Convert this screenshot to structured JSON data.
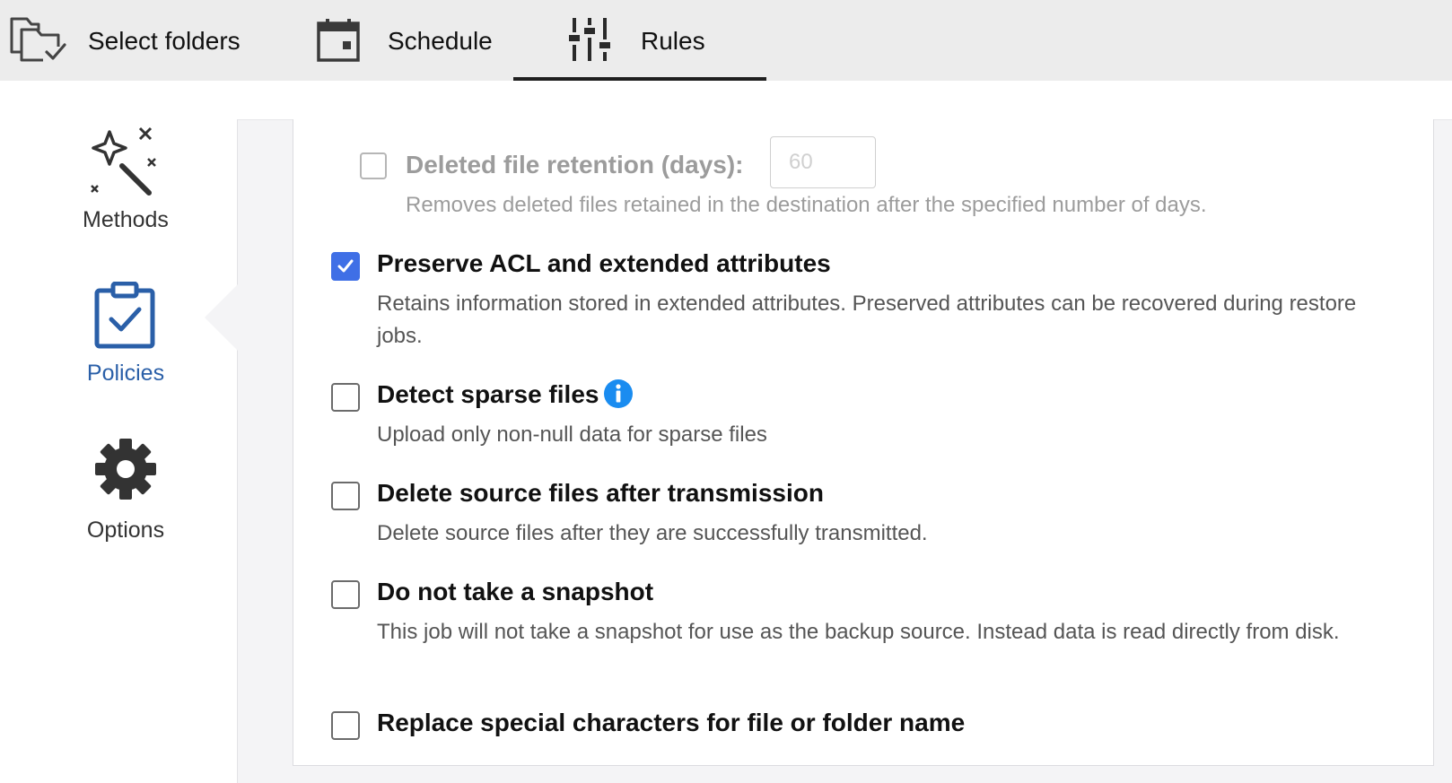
{
  "tabs": [
    {
      "label": "Select folders",
      "icon": "folder-check-icon"
    },
    {
      "label": "Schedule",
      "icon": "calendar-icon"
    },
    {
      "label": "Rules",
      "icon": "sliders-icon",
      "active": true
    }
  ],
  "sidebar": {
    "items": [
      {
        "label": "Methods",
        "icon": "magic-wand-icon"
      },
      {
        "label": "Policies",
        "icon": "clipboard-check-icon",
        "active": true
      },
      {
        "label": "Options",
        "icon": "gear-icon"
      }
    ]
  },
  "rules": {
    "retention": {
      "title": "Deleted file retention (days):",
      "placeholder": "60",
      "description": "Removes deleted files retained in the destination after the specified number of days.",
      "checked": false,
      "disabled": true
    },
    "preserve_acl": {
      "title": "Preserve ACL and extended attributes",
      "description": "Retains information stored in extended attributes. Preserved attributes can be recovered during restore jobs.",
      "checked": true
    },
    "sparse": {
      "title": "Detect sparse files",
      "description": "Upload only non-null data for sparse files",
      "checked": false
    },
    "delete_source": {
      "title": "Delete source files after transmission",
      "description": "Delete source files after they are successfully transmitted.",
      "checked": false
    },
    "no_snapshot": {
      "title": "Do not take a snapshot",
      "description": "This job will not take a snapshot for use as the backup source. Instead data is read directly from disk.",
      "checked": false
    },
    "replace_special": {
      "title": "Replace special characters for file or folder name",
      "checked": false
    }
  },
  "colors": {
    "accent": "#3f6fe6",
    "active_nav": "#2a5fa8",
    "info": "#1a8cf0",
    "tabbar_bg": "#ececec"
  }
}
